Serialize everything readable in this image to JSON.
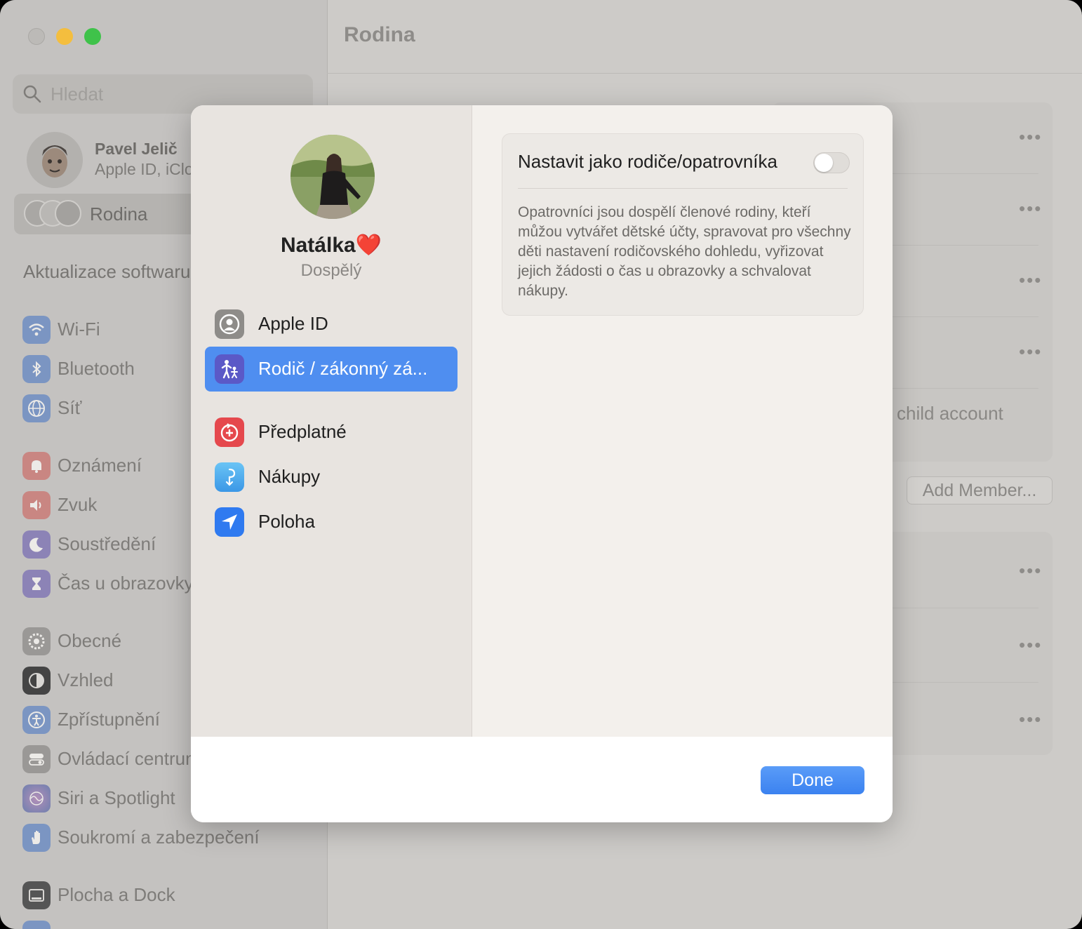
{
  "window": {
    "title": "Rodina"
  },
  "sidebar": {
    "search_placeholder": "Hledat",
    "profile": {
      "name": "Pavel Jelič",
      "subtitle": "Apple ID, iCloud"
    },
    "family_label": "Rodina",
    "software_update": "Aktualizace softwaru",
    "groups": [
      [
        {
          "label": "Wi-Fi",
          "icon": "wifi-icon",
          "color": "#7b95c2"
        },
        {
          "label": "Bluetooth",
          "icon": "bluetooth-icon",
          "color": "#7b95c2"
        },
        {
          "label": "Síť",
          "icon": "globe-icon",
          "color": "#7b95c2"
        }
      ],
      [
        {
          "label": "Oznámení",
          "icon": "bell-icon",
          "color": "#c98682"
        },
        {
          "label": "Zvuk",
          "icon": "speaker-icon",
          "color": "#c98682"
        },
        {
          "label": "Soustředění",
          "icon": "moon-icon",
          "color": "#8c83b6"
        },
        {
          "label": "Čas u obrazovky",
          "icon": "hourglass-icon",
          "color": "#8c83b6"
        }
      ],
      [
        {
          "label": "Obecné",
          "icon": "gear-icon",
          "color": "#9a9896"
        },
        {
          "label": "Vzhled",
          "icon": "appearance-icon",
          "color": "#444444"
        },
        {
          "label": "Zpřístupnění",
          "icon": "accessibility-icon",
          "color": "#7b95c2"
        },
        {
          "label": "Ovládací centrum",
          "icon": "control-center-icon",
          "color": "#9a9896"
        },
        {
          "label": "Siri a Spotlight",
          "icon": "siri-icon",
          "color": "#8c83b6"
        },
        {
          "label": "Soukromí a zabezpečení",
          "icon": "hand-icon",
          "color": "#7b95c2"
        }
      ],
      [
        {
          "label": "Plocha a Dock",
          "icon": "desktop-icon",
          "color": "#555555"
        }
      ]
    ]
  },
  "main": {
    "child_account_text": "child account",
    "add_member_label": "Add Member...",
    "more_label": "•••"
  },
  "modal": {
    "member_name": "Natálka❤️",
    "member_role": "Dospělý",
    "menu": [
      {
        "label": "Apple ID",
        "icon": "person-circle-icon",
        "selected": false
      },
      {
        "label": "Rodič / zákonný zá...",
        "icon": "family-icon",
        "selected": true
      },
      {
        "label": "Předplatné",
        "icon": "subscription-icon",
        "selected": false
      },
      {
        "label": "Nákupy",
        "icon": "purchases-icon",
        "selected": false
      },
      {
        "label": "Poloha",
        "icon": "location-arrow-icon",
        "selected": false
      }
    ],
    "guardian_toggle_label": "Nastavit jako rodiče/opatrovníka",
    "guardian_toggle_on": false,
    "guardian_description": "Opatrovníci jsou dospělí členové rodiny, kteří můžou vytvářet dětské účty, spravovat pro všechny děti nastavení rodičovského dohledu, vyřizovat jejich žádosti o čas u obrazovky a schvalovat nákupy.",
    "done_label": "Done",
    "accent_color": "#3b82f0"
  }
}
